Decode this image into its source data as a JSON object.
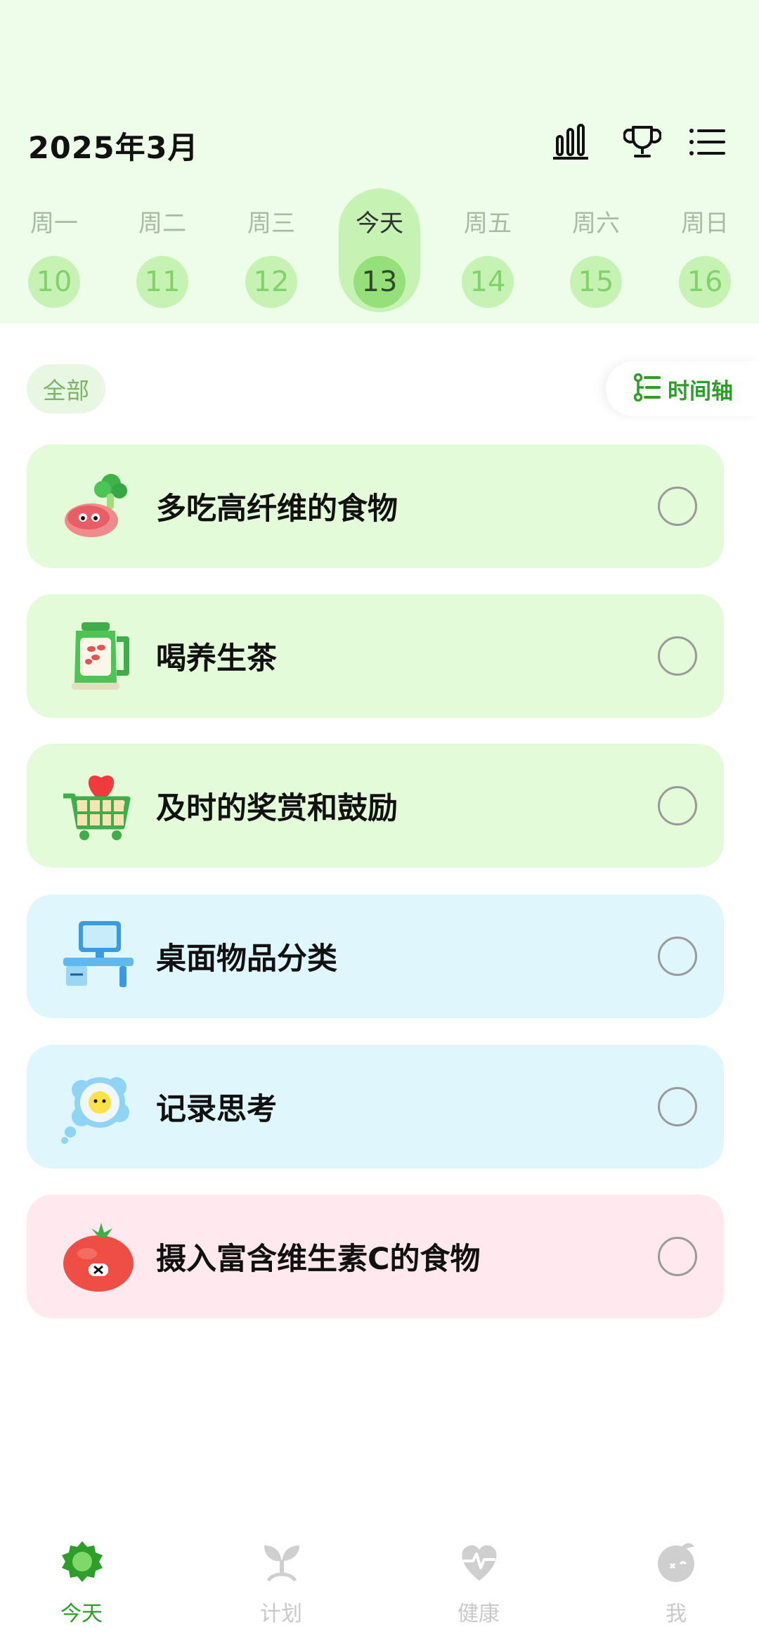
{
  "header": {
    "title": "2025年3月"
  },
  "week": [
    {
      "label": "周一",
      "day": "10"
    },
    {
      "label": "周二",
      "day": "11"
    },
    {
      "label": "周三",
      "day": "12"
    },
    {
      "label": "今天",
      "day": "13"
    },
    {
      "label": "周五",
      "day": "14"
    },
    {
      "label": "周六",
      "day": "15"
    },
    {
      "label": "周日",
      "day": "16"
    }
  ],
  "filter": {
    "label": "全部"
  },
  "timeline": {
    "label": "时间轴"
  },
  "tasks": [
    {
      "label": "多吃高纤维的食物",
      "icon": "broccoli-steak-icon",
      "color": "#e3fbd9"
    },
    {
      "label": "喝养生茶",
      "icon": "tea-kettle-icon",
      "color": "#e3fbd9"
    },
    {
      "label": "及时的奖赏和鼓励",
      "icon": "heart-cart-icon",
      "color": "#e3fbd9"
    },
    {
      "label": "桌面物品分类",
      "icon": "desk-computer-icon",
      "color": "#e0f6fd"
    },
    {
      "label": "记录思考",
      "icon": "thought-bubble-icon",
      "color": "#e0f6fd"
    },
    {
      "label": "摄入富含维生素C的食物",
      "icon": "tomato-icon",
      "color": "#ffe9ee"
    }
  ],
  "tabs": [
    {
      "label": "今天",
      "icon": "sun-icon"
    },
    {
      "label": "计划",
      "icon": "sprout-icon"
    },
    {
      "label": "健康",
      "icon": "heart-pulse-icon"
    },
    {
      "label": "我",
      "icon": "avatar-icon"
    }
  ],
  "colors": {
    "accent": "#2e9e2a",
    "header_bg": "#eefde9",
    "chip": "#c6f3b3"
  }
}
